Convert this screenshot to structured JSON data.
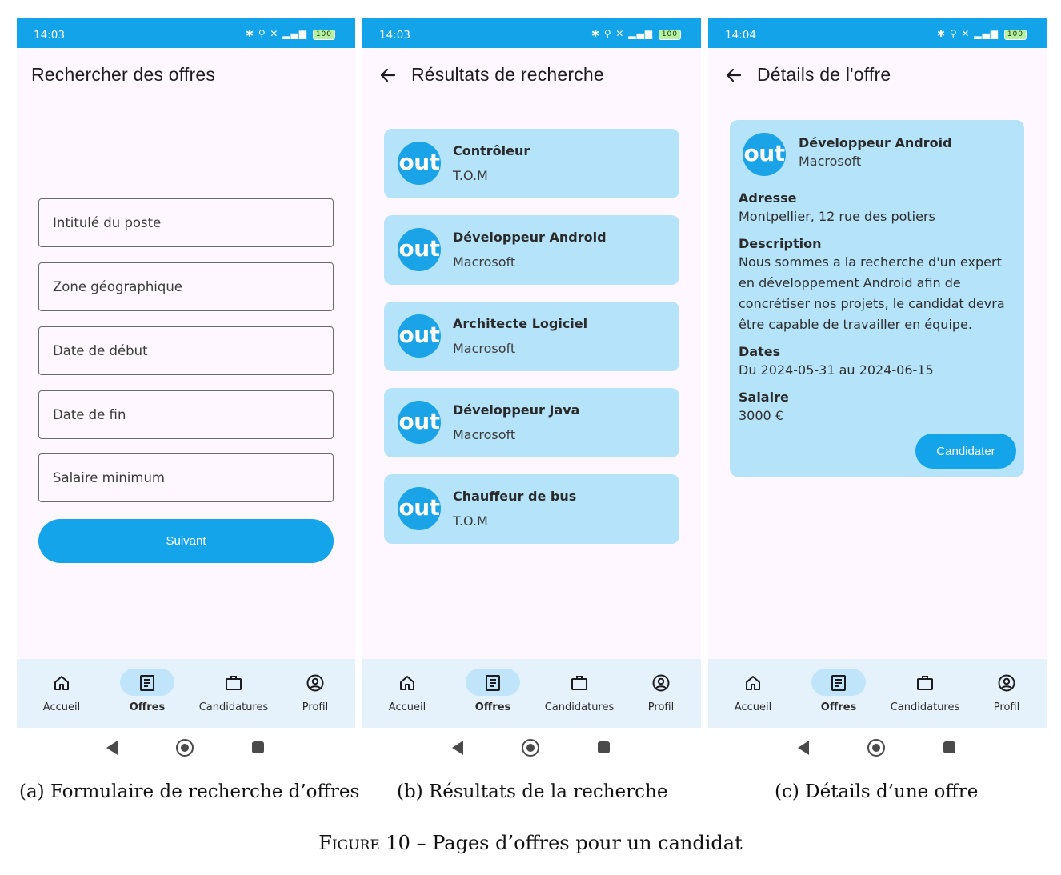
{
  "colors": {
    "status_bar": "#12a3e8",
    "primary": "#13a4e9",
    "card": "#b5e3fa",
    "nav_bar": "#e6f2fb",
    "nav_active_pill": "#c0e5fb",
    "screen_bg": "#fef7ff"
  },
  "screens": [
    {
      "status": {
        "time": "14:03",
        "icons": "✱ ⚲ ✕ ▂▄▆",
        "battery": "100"
      },
      "title": "Rechercher des offres",
      "form": {
        "fields": [
          {
            "placeholder": "Intitulé du poste"
          },
          {
            "placeholder": "Zone géographique"
          },
          {
            "placeholder": "Date de début"
          },
          {
            "placeholder": "Date de fin"
          },
          {
            "placeholder": "Salaire minimum"
          }
        ],
        "submit_label": "Suivant"
      },
      "caption": "(a) Formulaire de recherche d’offres"
    },
    {
      "status": {
        "time": "14:03",
        "icons": "✱ ⚲ ✕ ▂▄▆",
        "battery": "100"
      },
      "title": "Résultats de recherche",
      "results": [
        {
          "logo": "out",
          "title": "Contrôleur",
          "company": "T.O.M"
        },
        {
          "logo": "out",
          "title": "Développeur Android",
          "company": "Macrosoft"
        },
        {
          "logo": "out",
          "title": "Architecte Logiciel",
          "company": "Macrosoft"
        },
        {
          "logo": "out",
          "title": "Développeur Java",
          "company": "Macrosoft"
        },
        {
          "logo": "out",
          "title": "Chauffeur de bus",
          "company": "T.O.M"
        }
      ],
      "caption": "(b) Résultats de la recherche"
    },
    {
      "status": {
        "time": "14:04",
        "icons": "✱ ⚲ ✕ ▂▄▆",
        "battery": "100"
      },
      "title": "Détails de l'offre",
      "offer": {
        "logo": "out",
        "title": "Développeur Android",
        "company": "Macrosoft",
        "address_label": "Adresse",
        "address": "Montpellier, 12 rue des potiers",
        "description_label": "Description",
        "description": "Nous sommes a la recherche d'un expert en développement Android afin de concrétiser nos projets, le candidat devra être capable de travailler en équipe.",
        "dates_label": "Dates",
        "dates": "Du 2024-05-31 au 2024-06-15",
        "salary_label": "Salaire",
        "salary": "3000 €",
        "apply_label": "Candidater"
      },
      "caption": "(c) Détails d’une offre"
    }
  ],
  "bottom_nav": {
    "items": [
      {
        "label": "Accueil",
        "icon": "home-icon"
      },
      {
        "label": "Offres",
        "icon": "document-icon"
      },
      {
        "label": "Candidatures",
        "icon": "briefcase-icon"
      },
      {
        "label": "Profil",
        "icon": "account-circle-icon"
      }
    ],
    "active": "Offres"
  },
  "figure_caption": {
    "prefix": "Figure 10",
    "text": " – Pages d’offres pour un candidat"
  }
}
